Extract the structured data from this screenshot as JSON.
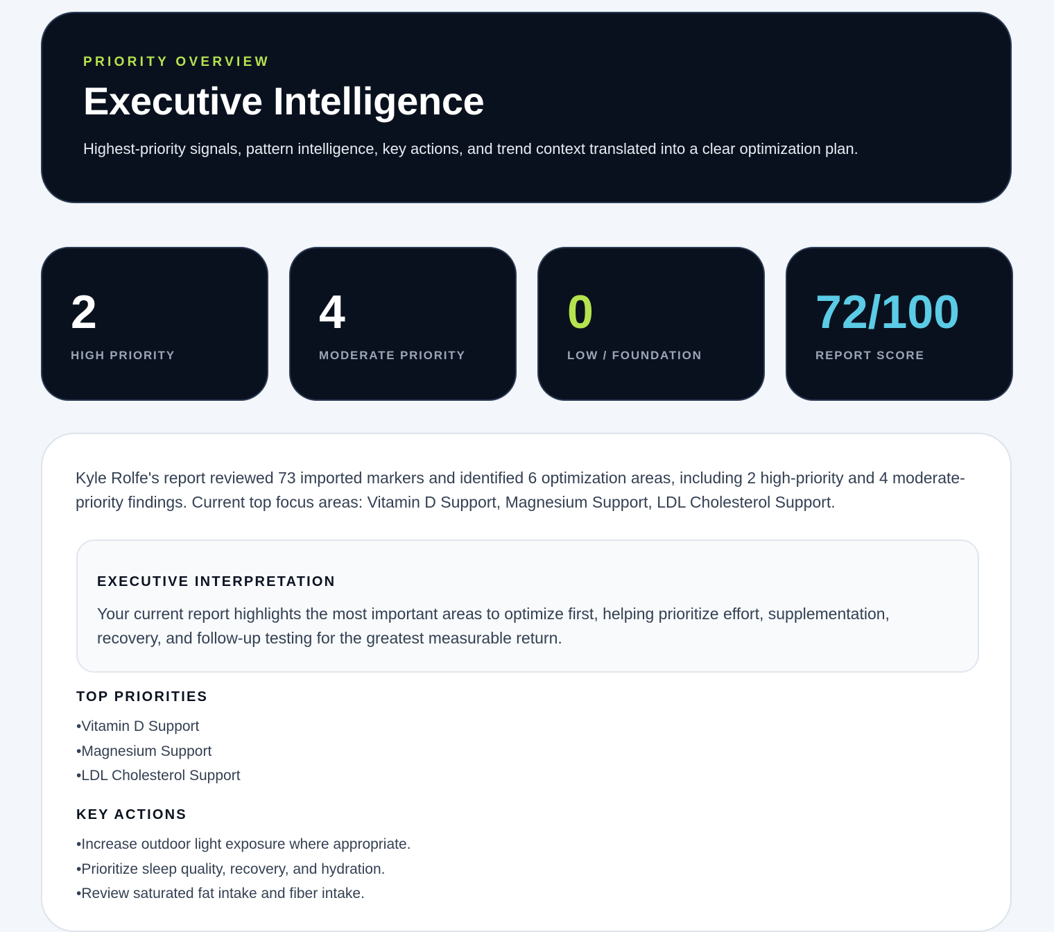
{
  "header": {
    "eyebrow": "PRIORITY OVERVIEW",
    "title": "Executive Intelligence",
    "subtitle": "Highest-priority signals, pattern intelligence, key actions, and trend context translated into a clear optimization plan."
  },
  "stats": [
    {
      "value": "2",
      "label": "HIGH PRIORITY",
      "color": "#ffffff"
    },
    {
      "value": "4",
      "label": "MODERATE PRIORITY",
      "color": "#ffffff"
    },
    {
      "value": "0",
      "label": "LOW / FOUNDATION",
      "color": "#b5e34f"
    },
    {
      "value": "72/100",
      "label": "REPORT SCORE",
      "color": "#5bcbe6"
    }
  ],
  "summary": "Kyle Rolfe's report reviewed 73 imported markers and identified 6 optimization areas, including 2 high-priority and 4 moderate-priority findings. Current top focus areas: Vitamin D Support, Magnesium Support, LDL Cholesterol Support.",
  "interpretation": {
    "title": "EXECUTIVE INTERPRETATION",
    "text": "Your current report highlights the most important areas to optimize first, helping prioritize effort, supplementation, recovery, and follow-up testing for the greatest measurable return."
  },
  "top_priorities": {
    "title": "TOP PRIORITIES",
    "items": [
      "Vitamin D Support",
      "Magnesium Support",
      "LDL Cholesterol Support"
    ]
  },
  "key_actions": {
    "title": "KEY ACTIONS",
    "items": [
      "Increase outdoor light exposure where appropriate.",
      "Prioritize sleep quality, recovery, and hydration.",
      "Review saturated fat intake and fiber intake."
    ]
  }
}
